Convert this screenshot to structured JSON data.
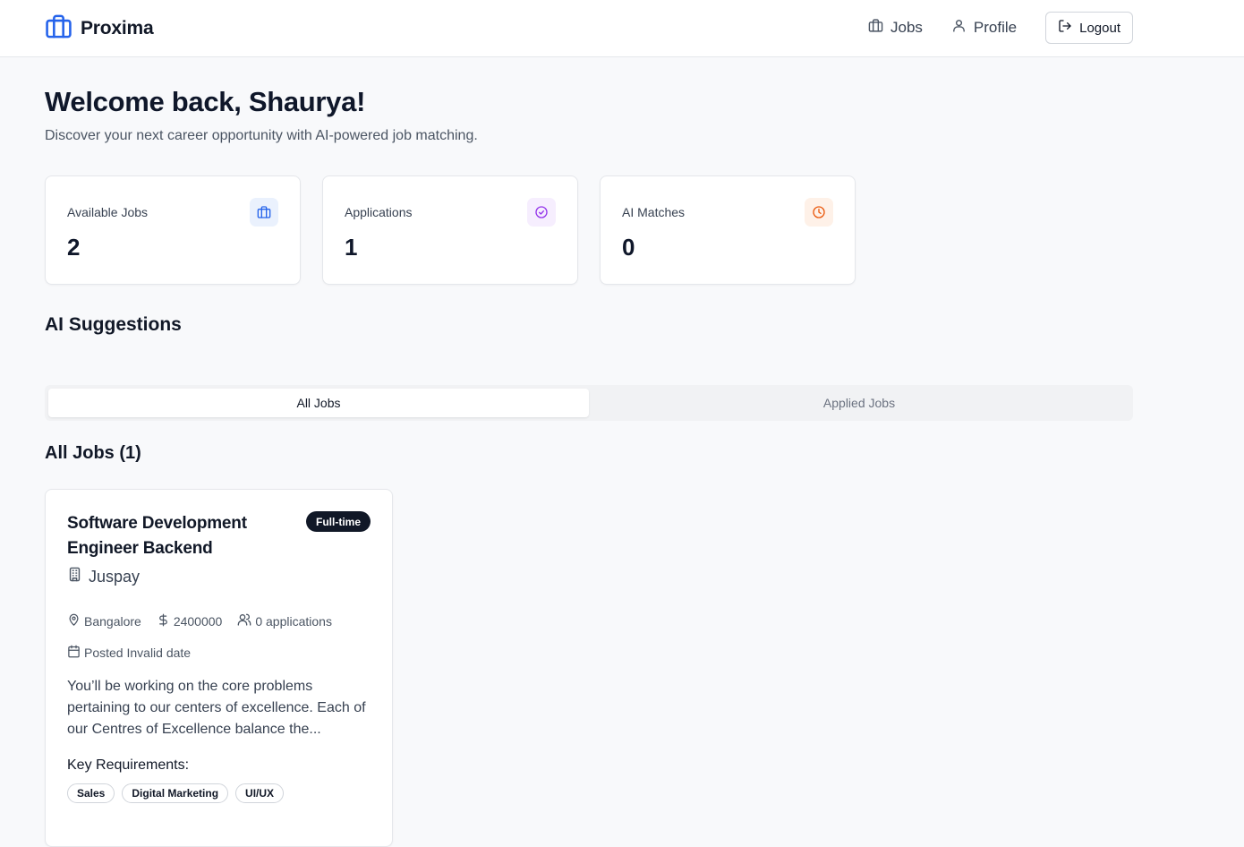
{
  "header": {
    "brand": "Proxima",
    "nav": {
      "jobs": "Jobs",
      "profile": "Profile",
      "logout": "Logout"
    }
  },
  "welcome": {
    "title": "Welcome back, Shaurya!",
    "subtitle": "Discover your next career opportunity with AI-powered job matching."
  },
  "stats": [
    {
      "label": "Available Jobs",
      "value": "2",
      "icon": "briefcase-icon",
      "color": "#2563eb",
      "bg": "#eaf1fd"
    },
    {
      "label": "Applications",
      "value": "1",
      "icon": "check-circle-icon",
      "color": "#9333ea",
      "bg": "#f6eefe"
    },
    {
      "label": "AI Matches",
      "value": "0",
      "icon": "clock-icon",
      "color": "#ea580c",
      "bg": "#fef1e8"
    }
  ],
  "ai_suggestions": {
    "title": "AI Suggestions"
  },
  "tabs": [
    {
      "label": "All Jobs",
      "active": true
    },
    {
      "label": "Applied Jobs",
      "active": false
    }
  ],
  "jobs_list": {
    "title": "All Jobs (1)",
    "jobs": [
      {
        "title": "Software Development Engineer Backend",
        "type": "Full-time",
        "company": "Juspay",
        "location": "Bangalore",
        "salary": "2400000",
        "applications": "0 applications",
        "posted": "Posted Invalid date",
        "description": "You’ll be working on the core problems pertaining to our centers of excellence. Each of our Centres of Excellence balance the...",
        "requirements_title": "Key Requirements:",
        "requirements": [
          "Sales",
          "Digital Marketing",
          "UI/UX"
        ]
      }
    ]
  }
}
